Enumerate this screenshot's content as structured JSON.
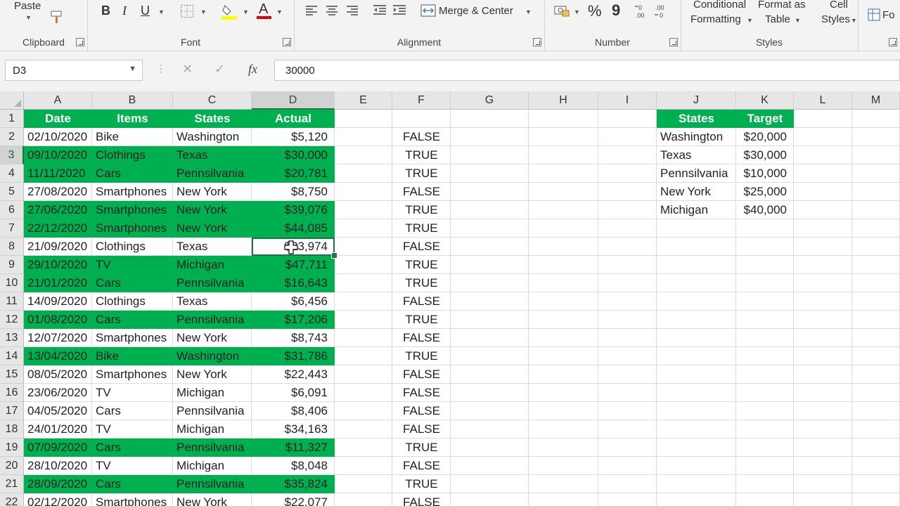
{
  "ribbon": {
    "clipboard": {
      "paste": "Paste",
      "label": "Clipboard"
    },
    "font": {
      "label": "Font",
      "bold": "B",
      "italic": "I",
      "underline": "U",
      "font_color_glyph": "A"
    },
    "alignment": {
      "label": "Alignment",
      "merge": "Merge & Center"
    },
    "number": {
      "label": "Number",
      "percent": "%",
      "comma": "9"
    },
    "styles": {
      "label": "Styles",
      "conditional_line1": "Conditional",
      "conditional_line2": "Formatting",
      "format_table_line1": "Format as",
      "format_table_line2": "Table",
      "cell_styles_line1": "Cell",
      "cell_styles_line2": "Styles",
      "next_partial": "Fo"
    }
  },
  "formula_bar": {
    "name_box": "D3",
    "cancel_glyph": "✕",
    "enter_glyph": "✓",
    "fx": "fx",
    "content": "30000"
  },
  "columns": [
    "A",
    "B",
    "C",
    "D",
    "E",
    "F",
    "G",
    "H",
    "I",
    "J",
    "K",
    "L",
    "M"
  ],
  "selected_cell": "D3",
  "table": {
    "headers": [
      "Date",
      "Items",
      "States",
      "Actual"
    ],
    "rows": [
      {
        "row": "2",
        "date": "02/10/2020",
        "item": "Bike",
        "state": "Washington",
        "actual": "$5,120",
        "check": "FALSE",
        "hl": false
      },
      {
        "row": "3",
        "date": "09/10/2020",
        "item": "Clothings",
        "state": "Texas",
        "actual": "$30,000",
        "check": "TRUE",
        "hl": true
      },
      {
        "row": "4",
        "date": "11/11/2020",
        "item": "Cars",
        "state": "Pennsilvania",
        "actual": "$20,781",
        "check": "TRUE",
        "hl": true
      },
      {
        "row": "5",
        "date": "27/08/2020",
        "item": "Smartphones",
        "state": "New York",
        "actual": "$8,750",
        "check": "FALSE",
        "hl": false
      },
      {
        "row": "6",
        "date": "27/06/2020",
        "item": "Smartphones",
        "state": "New York",
        "actual": "$39,076",
        "check": "TRUE",
        "hl": true
      },
      {
        "row": "7",
        "date": "22/12/2020",
        "item": "Smartphones",
        "state": "New York",
        "actual": "$44,085",
        "check": "TRUE",
        "hl": true
      },
      {
        "row": "8",
        "date": "21/09/2020",
        "item": "Clothings",
        "state": "Texas",
        "actual": "$23,974",
        "check": "FALSE",
        "hl": false
      },
      {
        "row": "9",
        "date": "29/10/2020",
        "item": "TV",
        "state": "Michigan",
        "actual": "$47,711",
        "check": "TRUE",
        "hl": true
      },
      {
        "row": "10",
        "date": "21/01/2020",
        "item": "Cars",
        "state": "Pennsilvania",
        "actual": "$16,643",
        "check": "TRUE",
        "hl": true
      },
      {
        "row": "11",
        "date": "14/09/2020",
        "item": "Clothings",
        "state": "Texas",
        "actual": "$6,456",
        "check": "FALSE",
        "hl": false
      },
      {
        "row": "12",
        "date": "01/08/2020",
        "item": "Cars",
        "state": "Pennsilvania",
        "actual": "$17,206",
        "check": "TRUE",
        "hl": true
      },
      {
        "row": "13",
        "date": "12/07/2020",
        "item": "Smartphones",
        "state": "New York",
        "actual": "$8,743",
        "check": "FALSE",
        "hl": false
      },
      {
        "row": "14",
        "date": "13/04/2020",
        "item": "Bike",
        "state": "Washington",
        "actual": "$31,786",
        "check": "TRUE",
        "hl": true
      },
      {
        "row": "15",
        "date": "08/05/2020",
        "item": "Smartphones",
        "state": "New York",
        "actual": "$22,443",
        "check": "FALSE",
        "hl": false
      },
      {
        "row": "16",
        "date": "23/06/2020",
        "item": "TV",
        "state": "Michigan",
        "actual": "$6,091",
        "check": "FALSE",
        "hl": false
      },
      {
        "row": "17",
        "date": "04/05/2020",
        "item": "Cars",
        "state": "Pennsilvania",
        "actual": "$8,406",
        "check": "FALSE",
        "hl": false
      },
      {
        "row": "18",
        "date": "24/01/2020",
        "item": "TV",
        "state": "Michigan",
        "actual": "$34,163",
        "check": "FALSE",
        "hl": false
      },
      {
        "row": "19",
        "date": "07/09/2020",
        "item": "Cars",
        "state": "Pennsilvania",
        "actual": "$11,327",
        "check": "TRUE",
        "hl": true
      },
      {
        "row": "20",
        "date": "28/10/2020",
        "item": "TV",
        "state": "Michigan",
        "actual": "$8,048",
        "check": "FALSE",
        "hl": false
      },
      {
        "row": "21",
        "date": "28/09/2020",
        "item": "Cars",
        "state": "Pennsilvania",
        "actual": "$35,824",
        "check": "TRUE",
        "hl": true
      },
      {
        "row": "22",
        "date": "02/12/2020",
        "item": "Smartphones",
        "state": "New York",
        "actual": "$22,077",
        "check": "FALSE",
        "hl": false
      }
    ]
  },
  "targets": {
    "headers": [
      "States",
      "Target"
    ],
    "rows": [
      {
        "state": "Washington",
        "target": "$20,000"
      },
      {
        "state": "Texas",
        "target": "$30,000"
      },
      {
        "state": "Pennsilvania",
        "target": "$10,000"
      },
      {
        "state": "New York",
        "target": "$25,000"
      },
      {
        "state": "Michigan",
        "target": "$40,000"
      }
    ]
  },
  "colors": {
    "highlight": "#00b050",
    "excel_green": "#217346"
  }
}
